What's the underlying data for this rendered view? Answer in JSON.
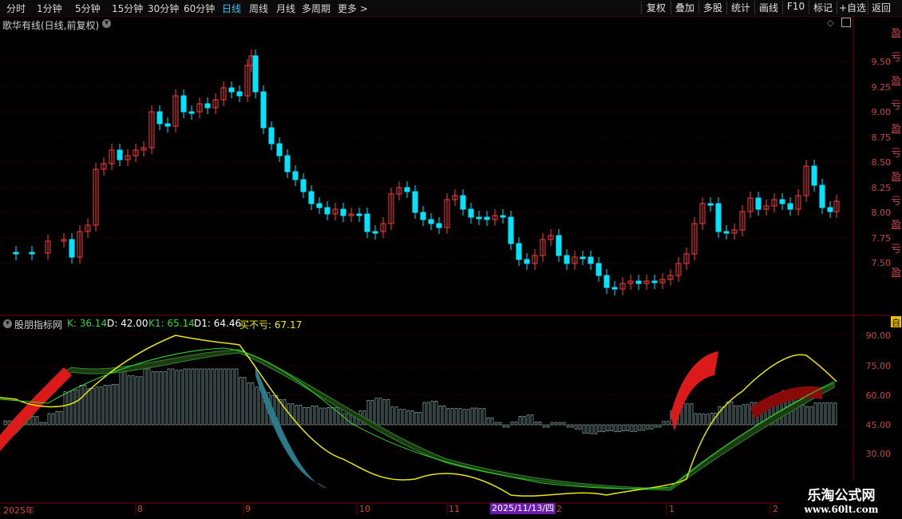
{
  "toolbar": {
    "periods": [
      "分时",
      "1分钟",
      "5分钟",
      "15分钟",
      "30分钟",
      "60分钟",
      "日线",
      "周线",
      "月线",
      "多周期",
      "更多 >"
    ],
    "active_period": "日线",
    "buttons": [
      "复权",
      "叠加",
      "多股",
      "统计",
      "画线",
      "F10",
      "标记",
      "+自选",
      "返回"
    ]
  },
  "price_panel": {
    "title": "歌华有线(日线,前复权)",
    "axis_labels": [
      "9.50",
      "9.25",
      "9.00",
      "8.75",
      "8.50",
      "8.25",
      "8.00",
      "7.75",
      "7.50"
    ]
  },
  "indicator_panel": {
    "name": "股朋指标网",
    "values": [
      {
        "text": "K: 36.14",
        "color": "#2ddc2d"
      },
      {
        "text": "D: 42.00",
        "color": "#ffffff"
      },
      {
        "text": "K1: 65.14",
        "color": "#2ddc2d"
      },
      {
        "text": "D1: 64.46",
        "color": "#ffffff"
      },
      {
        "text": "买不亏: 67.17",
        "color": "#f0f000"
      }
    ],
    "axis_labels": [
      "90.00",
      "75.00",
      "60.00",
      "45.00",
      "30.00"
    ]
  },
  "date_axis": [
    "2025年",
    "8",
    "9",
    "10",
    "11",
    "2",
    "1",
    "2"
  ],
  "cursor_date": "2025/11/13/四",
  "right_labels": [
    "盈",
    "亏",
    "盈",
    "亏",
    "盈",
    "亏",
    "盈",
    "亏",
    "盈",
    "亏",
    "盈"
  ],
  "right_bottom_label": "自",
  "watermark": {
    "line1": "乐淘公式网",
    "line2": "www.60lt.com"
  },
  "colors": {
    "up": "#ff3c3c",
    "down": "#00e5ff",
    "axis": "#c84848",
    "active": "#33c3ff"
  }
}
